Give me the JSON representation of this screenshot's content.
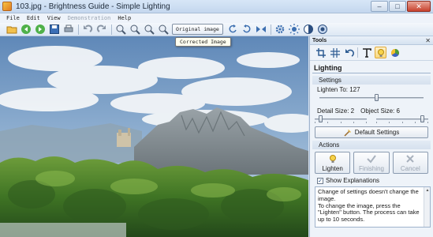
{
  "window": {
    "title": "103.jpg - Brightness Guide - Simple Lighting",
    "buttons": {
      "minimize": "–",
      "maximize": "□",
      "close": "✕"
    }
  },
  "menu": [
    "File",
    "Edit",
    "View",
    "Demonstration",
    "Help"
  ],
  "toolbar": {
    "view_toggle_label": "Original image",
    "icons": [
      "open-icon",
      "back-arrow-icon",
      "forward-arrow-icon",
      "save-icon",
      "print-icon",
      "undo-icon",
      "redo-icon",
      "zoom-in-icon",
      "zoom-out-icon",
      "zoom-fit-icon",
      "zoom-actual-icon",
      "rotate-left-icon",
      "rotate-right-icon",
      "flip-icon",
      "settings-icon",
      "brightness-icon",
      "contrast-icon",
      "color-icon"
    ]
  },
  "tooltip": "Corrected Image",
  "tools_panel": {
    "title": "Tools",
    "close": "✕",
    "tool_icons": [
      "crop-icon",
      "grid-icon",
      "undo-tool-icon",
      "text-icon",
      "lighting-icon",
      "color-wheel-icon"
    ],
    "section_title": "Lighting",
    "settings": {
      "header": "Settings",
      "lighten_label": "Lighten To: 127",
      "lighten_value": 0.55,
      "detail_label": "Detail Size: 2",
      "object_label": "Object Size: 6",
      "detail_value": 0.08,
      "object_value": 0.92,
      "default_button": "Default Settings"
    },
    "actions": {
      "header": "Actions",
      "lighten": "Lighten",
      "finishing": "Finishing",
      "cancel": "Cancel"
    },
    "show_explanations": {
      "label": "Show Explanations",
      "checked": true
    },
    "explanation_lines": [
      "Change of settings doesn't change the image.",
      "To change the image, press the \"Lighten\" button. The process can take up to 10 seconds."
    ]
  }
}
